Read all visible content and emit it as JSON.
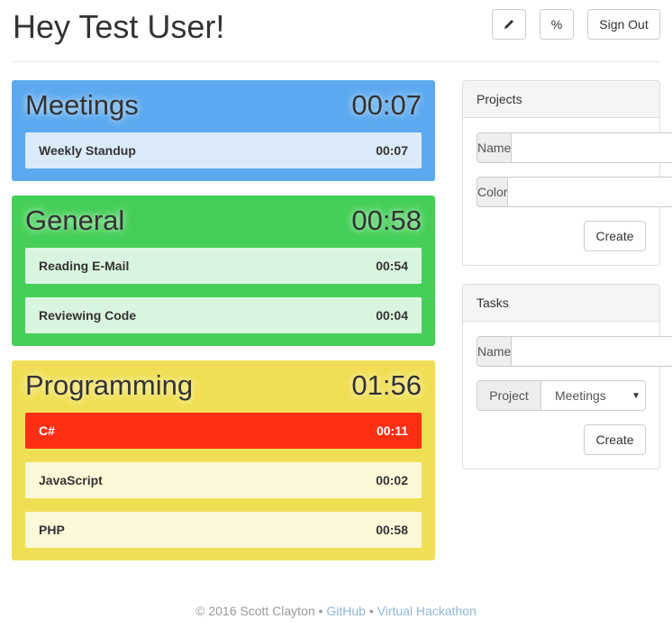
{
  "header": {
    "title": "Hey Test User!",
    "edit_icon": "pencil-icon",
    "percent_label": "%",
    "signout_label": "Sign Out"
  },
  "projects": [
    {
      "name": "Meetings",
      "time": "00:07",
      "color": "#5ca9ef",
      "tasks": [
        {
          "name": "Weekly Standup",
          "time": "00:07",
          "active": false
        }
      ]
    },
    {
      "name": "General",
      "time": "00:58",
      "color": "#46cf58",
      "tasks": [
        {
          "name": "Reading E-Mail",
          "time": "00:54",
          "active": false
        },
        {
          "name": "Reviewing Code",
          "time": "00:04",
          "active": false
        }
      ]
    },
    {
      "name": "Programming",
      "time": "01:56",
      "color": "#f0df55",
      "tasks": [
        {
          "name": "C#",
          "time": "00:11",
          "active": true,
          "active_color": "#ff2f16"
        },
        {
          "name": "JavaScript",
          "time": "00:02",
          "active": false
        },
        {
          "name": "PHP",
          "time": "00:58",
          "active": false
        }
      ]
    }
  ],
  "projects_panel": {
    "title": "Projects",
    "name_label": "Name",
    "name_value": "",
    "color_label": "Color",
    "color_value": "",
    "create_label": "Create"
  },
  "tasks_panel": {
    "title": "Tasks",
    "name_label": "Name",
    "name_value": "",
    "project_label": "Project",
    "project_selected": "Meetings",
    "create_label": "Create"
  },
  "footer": {
    "copyright": "© 2016 Scott Clayton",
    "sep": "•",
    "github": "GitHub",
    "hackathon": "Virtual Hackathon"
  }
}
